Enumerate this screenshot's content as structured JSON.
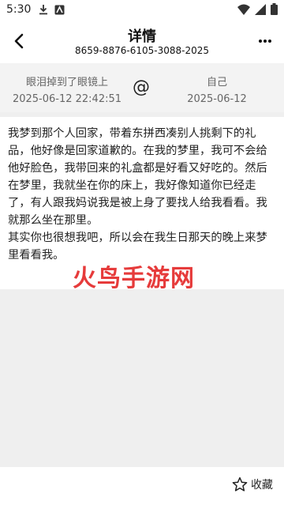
{
  "status_bar": {
    "time": "5:30"
  },
  "app_bar": {
    "title": "详情",
    "subtitle": "8659-8876-6105-3088-2025"
  },
  "header": {
    "from": {
      "name": "眼泪掉到了眼镜上",
      "time": "2025-06-12 22:42:51"
    },
    "at_symbol": "@",
    "to": {
      "name": "自己",
      "time": "2025-06-12"
    }
  },
  "content": {
    "body": "我梦到那个人回家，带着东拼西凑别人挑剩下的礼品，他好像是回家道歉的。在我的梦里，我可不会给他好脸色，我带回来的礼盒都是好看又好吃的。然后在梦里，我就坐在你的床上，我好像知道你已经走了，有人跟我妈说我是被上身了要找人给我看看。我就那么坐在那里。\n其实你也很想我吧，所以会在我生日那天的晚上来梦里看看我。"
  },
  "watermark": "火鸟手游网",
  "bottom_bar": {
    "collect_label": "收藏"
  }
}
